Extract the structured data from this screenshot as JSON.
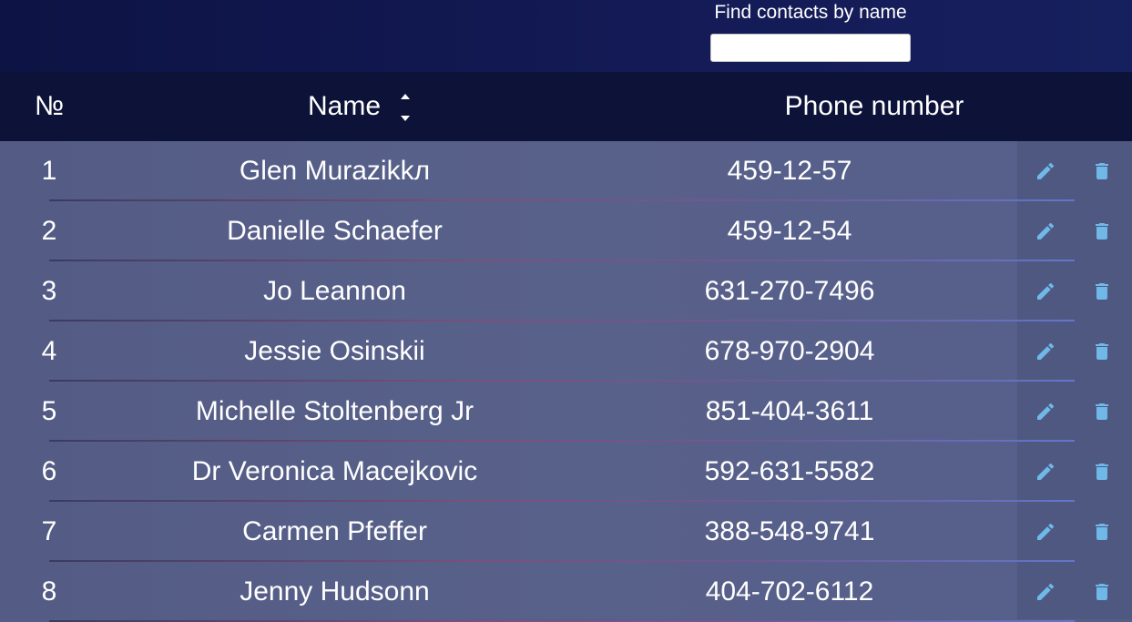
{
  "search": {
    "label": "Find contacts by name",
    "value": "",
    "placeholder": ""
  },
  "table": {
    "headers": {
      "number": "№",
      "name": "Name",
      "phone": "Phone number"
    },
    "sort_icon": "sort-arrows-icon",
    "rows": [
      {
        "num": "1",
        "name": "Glen Murazikkл",
        "phone": "459-12-57"
      },
      {
        "num": "2",
        "name": "Danielle Schaefer",
        "phone": "459-12-54"
      },
      {
        "num": "3",
        "name": "Jo Leannon",
        "phone": "631-270-7496"
      },
      {
        "num": "4",
        "name": "Jessie Osinskii",
        "phone": "678-970-2904"
      },
      {
        "num": "5",
        "name": "Michelle Stoltenberg Jr",
        "phone": "851-404-3611"
      },
      {
        "num": "6",
        "name": "Dr Veronica Macejkovic",
        "phone": "592-631-5582"
      },
      {
        "num": "7",
        "name": "Carmen Pfeffer",
        "phone": "388-548-9741"
      },
      {
        "num": "8",
        "name": "Jenny Hudsonn",
        "phone": "404-702-6112"
      }
    ],
    "row_actions": {
      "edit_icon": "pencil-icon",
      "delete_icon": "trash-icon"
    }
  },
  "colors": {
    "header_bg": "#131a55",
    "table_head_bg": "#0d1238",
    "body_bg": "#565f8a",
    "icon_color": "#6fb8e8"
  }
}
